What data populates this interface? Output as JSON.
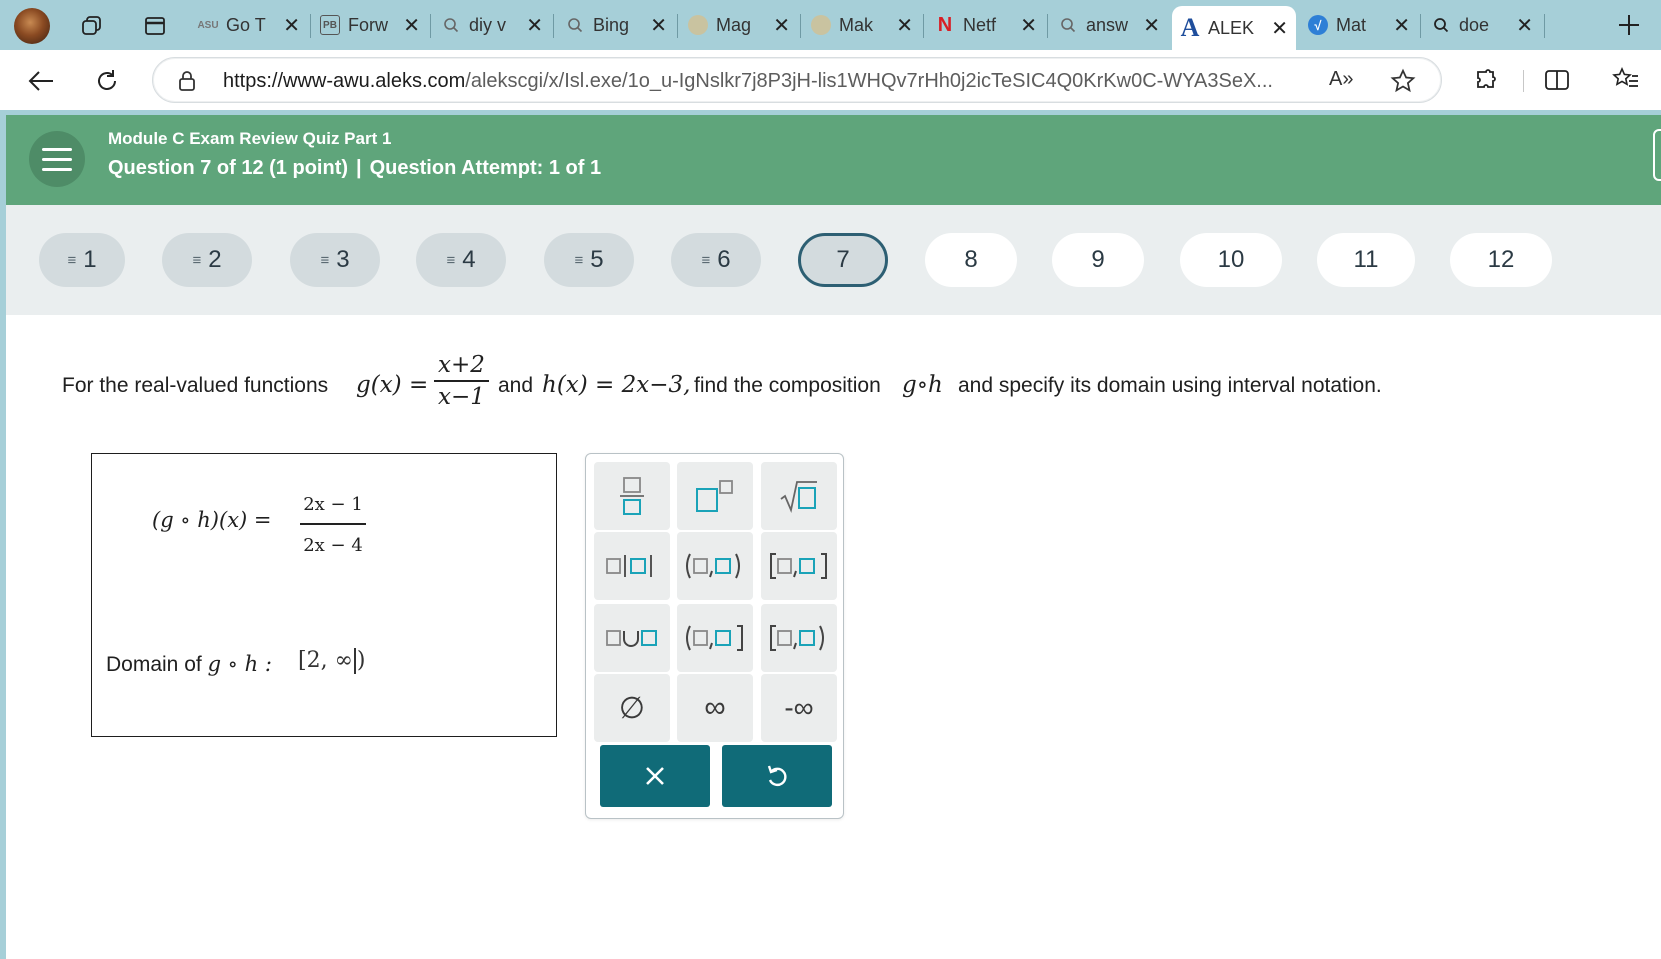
{
  "browser": {
    "tabs": [
      {
        "label": "Go T",
        "favicon": "asu-icon"
      },
      {
        "label": "Forw",
        "favicon": "pb-icon"
      },
      {
        "label": "diy v",
        "favicon": "search-icon"
      },
      {
        "label": "Bing",
        "favicon": "search-icon"
      },
      {
        "label": "Mag",
        "favicon": "image-icon"
      },
      {
        "label": "Mak",
        "favicon": "image-icon"
      },
      {
        "label": "Netf",
        "favicon": "netflix-icon"
      },
      {
        "label": "answ",
        "favicon": "search-icon"
      },
      {
        "label": "ALEK",
        "favicon": "aleks-icon"
      },
      {
        "label": "Mat",
        "favicon": "math-icon"
      },
      {
        "label": "doe",
        "favicon": "search-icon"
      }
    ],
    "active_tab_index": 8,
    "tab_favicon_text": {
      "asu": "ASU",
      "pb": "PB",
      "netflix": "N",
      "aleks": "A"
    },
    "url_host": "https://www-awu.aleks.com",
    "url_path": "/alekscgi/x/Isl.exe/1o_u-IgNslkr7j8P3jH-lis1WHQv7rHh0j2icTeSIC4Q0KrKw0C-WYA3SeX...",
    "read_aloud_label": "A»"
  },
  "header": {
    "title": "Module C Exam Review Quiz Part 1",
    "question_info": "Question 7 of 12 (1 point)",
    "separator": "|",
    "attempt_info": "Question Attempt: 1 of 1",
    "color": "#5fa57b"
  },
  "navigator": {
    "questions": [
      {
        "number": "1",
        "state": "done"
      },
      {
        "number": "2",
        "state": "done"
      },
      {
        "number": "3",
        "state": "done"
      },
      {
        "number": "4",
        "state": "done"
      },
      {
        "number": "5",
        "state": "done"
      },
      {
        "number": "6",
        "state": "done"
      },
      {
        "number": "7",
        "state": "current"
      },
      {
        "number": "8",
        "state": "todo"
      },
      {
        "number": "9",
        "state": "todo"
      },
      {
        "number": "10",
        "state": "todo"
      },
      {
        "number": "11",
        "state": "todo"
      },
      {
        "number": "12",
        "state": "todo"
      }
    ],
    "done_marker": "≡"
  },
  "question": {
    "intro": "For the real-valued functions",
    "g_lhs": "g(x) =",
    "g_num": "x+2",
    "g_den": "x−1",
    "and_text": "and",
    "h_def": "h(x) = 2x−3,",
    "find_text": "find the composition",
    "comp": "g∘h",
    "outro": "and specify its domain using interval notation."
  },
  "answer": {
    "lhs": "(g ∘ h)(x)  =",
    "num": "2x − 1",
    "den": "2x − 4",
    "domain_label": "Domain of",
    "domain_func": "g ∘ h  :",
    "domain_value_open": "[2, ∞",
    "domain_value_close": ")"
  },
  "keypad": {
    "keys": [
      {
        "name": "fraction-key",
        "glyph": ""
      },
      {
        "name": "superscript-key",
        "glyph": ""
      },
      {
        "name": "sqrt-key",
        "glyph": ""
      },
      {
        "name": "abs-value-key",
        "glyph": ""
      },
      {
        "name": "open-open-interval-key",
        "glyph": ""
      },
      {
        "name": "closed-closed-interval-key",
        "glyph": ""
      },
      {
        "name": "union-key",
        "glyph": ""
      },
      {
        "name": "open-closed-interval-key",
        "glyph": ""
      },
      {
        "name": "closed-open-interval-key",
        "glyph": ""
      },
      {
        "name": "empty-set-key",
        "glyph": "∅"
      },
      {
        "name": "infinity-key",
        "glyph": "∞"
      },
      {
        "name": "neg-infinity-key",
        "glyph": "-∞"
      }
    ],
    "accent": "#1aa3b8",
    "action_color": "#106b78"
  }
}
